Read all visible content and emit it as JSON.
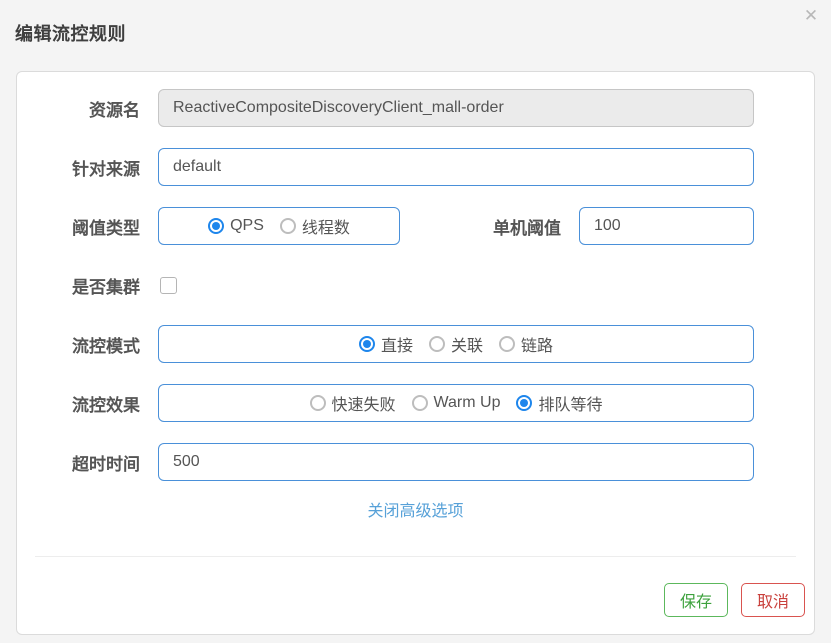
{
  "dialog": {
    "title": "编辑流控规则",
    "close_icon": "✕"
  },
  "form": {
    "resource": {
      "label": "资源名",
      "value": "ReactiveCompositeDiscoveryClient_mall-order",
      "disabled": true
    },
    "limit_app": {
      "label": "针对来源",
      "value": "default"
    },
    "grade": {
      "label": "阈值类型",
      "options": [
        {
          "label": "QPS",
          "selected": true
        },
        {
          "label": "线程数",
          "selected": false
        }
      ]
    },
    "threshold": {
      "label": "单机阈值",
      "value": "100"
    },
    "cluster": {
      "label": "是否集群",
      "checked": false
    },
    "strategy": {
      "label": "流控模式",
      "options": [
        {
          "label": "直接",
          "selected": true
        },
        {
          "label": "关联",
          "selected": false
        },
        {
          "label": "链路",
          "selected": false
        }
      ]
    },
    "control_behavior": {
      "label": "流控效果",
      "options": [
        {
          "label": "快速失败",
          "selected": false
        },
        {
          "label": "Warm Up",
          "selected": false
        },
        {
          "label": "排队等待",
          "selected": true
        }
      ]
    },
    "timeout": {
      "label": "超时时间",
      "value": "500"
    },
    "advanced_link": "关闭高级选项"
  },
  "footer": {
    "save_label": "保存",
    "cancel_label": "取消"
  },
  "colors": {
    "accent_border": "#4a90d9",
    "radio_selected": "#1e86ec",
    "link_blue": "#57a1d8",
    "save_green": "#5cb85c",
    "cancel_red": "#d9534f",
    "surface": "#f4f4f4",
    "panel": "#ffffff"
  }
}
